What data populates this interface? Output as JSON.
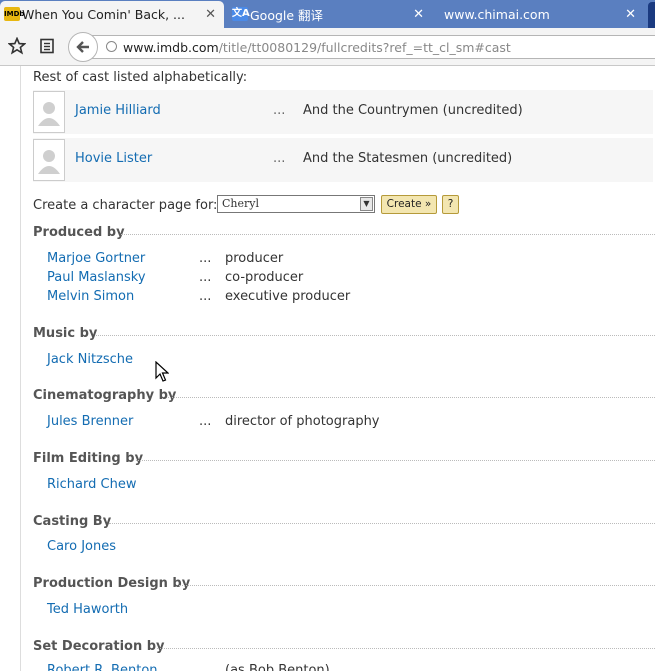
{
  "tabs": [
    {
      "title": "When You Comin' Back, ...",
      "favicon": "IMDb",
      "close": "✕"
    },
    {
      "title": "Google 翻译",
      "favicon": "文A",
      "close": "✕"
    },
    {
      "title": "www.chimai.com",
      "favicon": "",
      "close": "✕"
    }
  ],
  "toolbar": {
    "url_domain": "www.imdb.com",
    "url_path": "/title/tt0080129/fullcredits?ref_=tt_cl_sm#cast",
    "icons": [
      "star-icon",
      "reader-icon",
      "back-arrow-icon",
      "globe-icon"
    ]
  },
  "cast": {
    "intro": "Rest of cast listed alphabetically:",
    "dots": "...",
    "rows": [
      {
        "name": "Jamie Hilliard",
        "character": "And the Countrymen (uncredited)"
      },
      {
        "name": "Hovie Lister",
        "character": "And the Statesmen (uncredited)"
      }
    ]
  },
  "charpage": {
    "label": "Create a character page for:",
    "selected": "Cheryl",
    "create_label": "Create »",
    "help_label": "?"
  },
  "sections": [
    {
      "title": "Produced by",
      "credits": [
        {
          "name": "Marjoe Gortner",
          "dots": "...",
          "role": "producer"
        },
        {
          "name": "Paul Maslansky",
          "dots": "...",
          "role": "co-producer"
        },
        {
          "name": "Melvin Simon",
          "dots": "...",
          "role": "executive producer"
        }
      ]
    },
    {
      "title": "Music by",
      "credits": [
        {
          "name": "Jack Nitzsche",
          "dots": "",
          "role": ""
        }
      ]
    },
    {
      "title": "Cinematography by",
      "credits": [
        {
          "name": "Jules Brenner",
          "dots": "...",
          "role": "director of photography"
        }
      ]
    },
    {
      "title": "Film Editing by",
      "credits": [
        {
          "name": "Richard Chew",
          "dots": "",
          "role": ""
        }
      ]
    },
    {
      "title": "Casting By",
      "credits": [
        {
          "name": "Caro Jones",
          "dots": "",
          "role": ""
        }
      ]
    },
    {
      "title": "Production Design by",
      "credits": [
        {
          "name": "Ted Haworth",
          "dots": "",
          "role": ""
        }
      ]
    },
    {
      "title": "Set Decoration by",
      "credits": [
        {
          "name": "Robert R. Benton",
          "dots": "",
          "role": "(as Bob Benton)"
        }
      ]
    }
  ]
}
